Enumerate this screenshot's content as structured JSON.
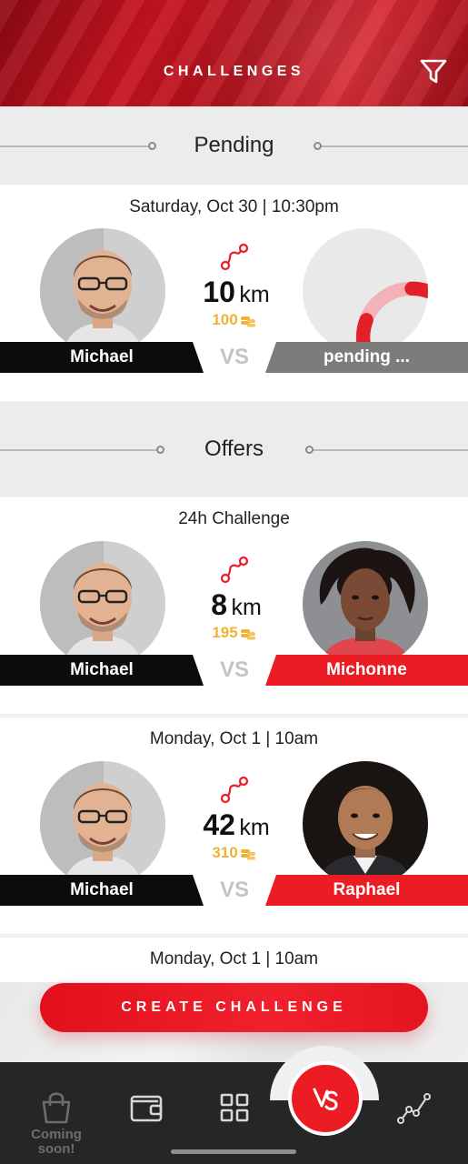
{
  "header": {
    "title": "CHALLENGES",
    "filter_icon": "filter-icon"
  },
  "sections": {
    "pending": "Pending",
    "offers": "Offers"
  },
  "pending_card": {
    "date": "Saturday, Oct 30 | 10:30pm",
    "distance": "10",
    "unit": "km",
    "coins": "100",
    "left_name": "Michael",
    "vs": "VS",
    "right_name": "pending ..."
  },
  "offer_cards": [
    {
      "date": "24h Challenge",
      "distance": "8",
      "unit": "km",
      "coins": "195",
      "left_name": "Michael",
      "vs": "VS",
      "right_name": "Michonne"
    },
    {
      "date": "Monday, Oct 1 | 10am",
      "distance": "42",
      "unit": "km",
      "coins": "310",
      "left_name": "Michael",
      "vs": "VS",
      "right_name": "Raphael"
    }
  ],
  "next_date": "Monday, Oct 1 | 10am",
  "create_button": "CREATE CHALLENGE",
  "tabbar": {
    "coming_soon": "Coming soon!",
    "icons": [
      "bag-icon",
      "wallet-icon",
      "grid-icon",
      "versus-icon",
      "stats-icon"
    ]
  },
  "colors": {
    "accent": "#ec1c24",
    "coins": "#f1b233",
    "tabbar": "#262626"
  }
}
